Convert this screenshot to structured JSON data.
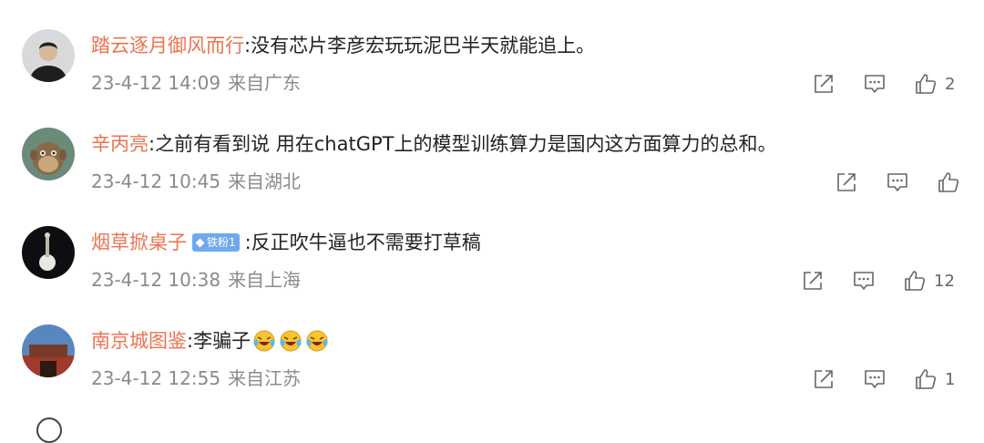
{
  "comments": [
    {
      "username": "踏云逐月御风而行",
      "text": "没有芯片李彦宏玩玩泥巴半天就能追上。",
      "time": "23-4-12 14:09",
      "location": "来自广东",
      "likes": "2"
    },
    {
      "username": "辛丙亮",
      "text": "之前有看到说 用在chatGPT上的模型训练算力是国内这方面算力的总和。",
      "time": "23-4-12 10:45",
      "location": "来自湖北",
      "likes": ""
    },
    {
      "username": "烟草掀桌子",
      "badge": "铁粉1",
      "text": "反正吹牛逼也不需要打草稿",
      "time": "23-4-12 10:38",
      "location": "来自上海",
      "likes": "12"
    },
    {
      "username": "南京城图鉴",
      "text": "李骗子",
      "emojis": [
        "laughing-crying-emoji",
        "laughing-crying-emoji",
        "laughing-crying-emoji"
      ],
      "time": "23-4-12 12:55",
      "location": "来自江苏",
      "likes": "1"
    }
  ],
  "colors": {
    "username": "#eb7350",
    "text": "#222222",
    "meta": "#8a8a8a",
    "icon": "#666666",
    "badge": "#6fa8f0"
  },
  "icons": [
    "share-icon",
    "comment-icon",
    "thumbs-up-icon"
  ]
}
